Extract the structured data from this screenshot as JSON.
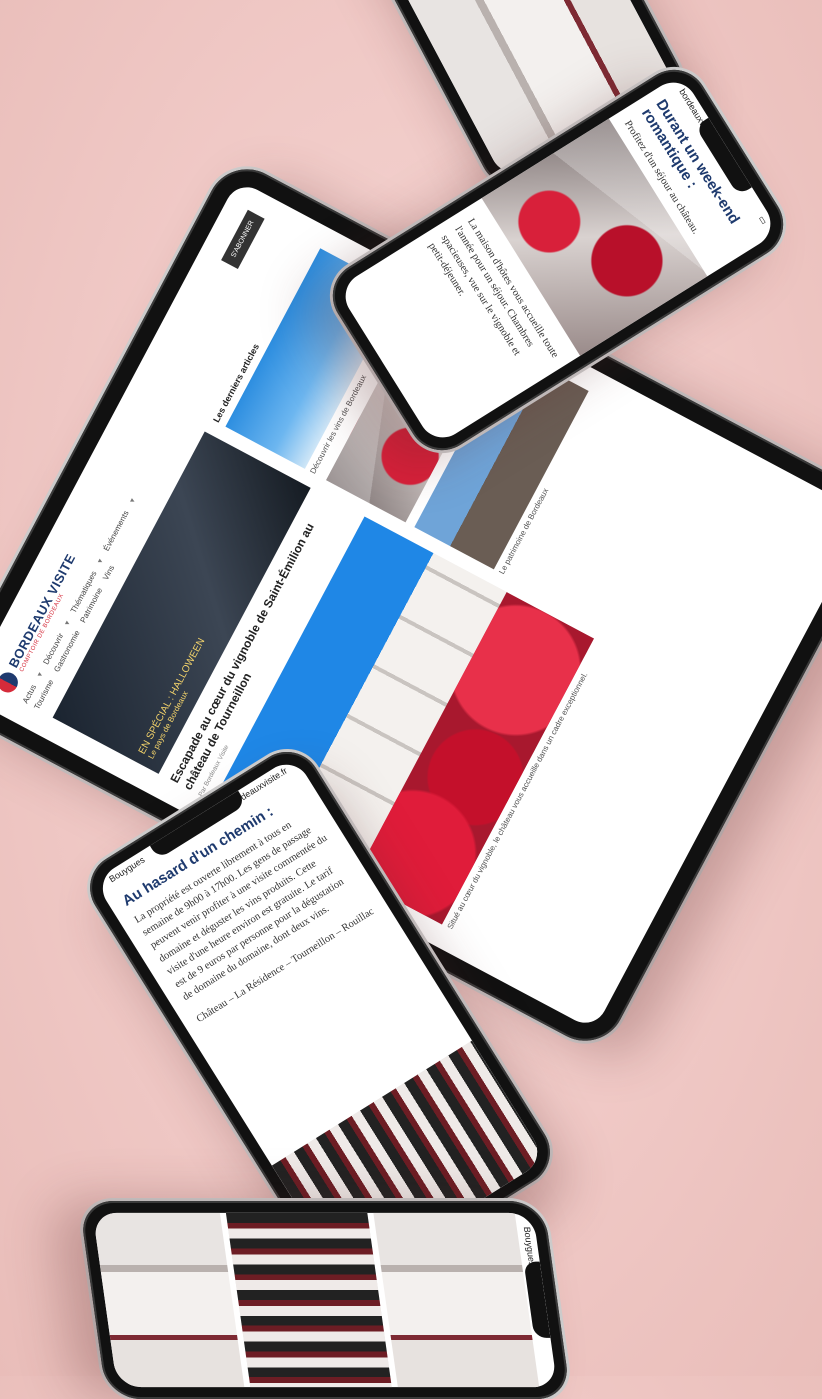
{
  "colors": {
    "background": "#f0c9c6",
    "accent_blue": "#1e3a6e",
    "accent_red": "#d52b3a"
  },
  "tablet": {
    "logo_title": "BORDEAUX VISITE",
    "logo_subtitle": "COMPTOIR DE BORDEAUX",
    "nav": [
      "Actus",
      "Découvrir",
      "Thématiques",
      "Événements"
    ],
    "nav_row2": [
      "Tourisme",
      "Gastronomie",
      "Patrimoine",
      "Vins"
    ],
    "button_label": "S'ABONNER",
    "featured_heading": "En spécial : halloween",
    "featured_caption": "Le pays de Bordeaux",
    "article_title": "Escapade au cœur du vignoble de Saint-Émilion au château de Tourneillon",
    "article_meta": "Par Bordeaux Visite",
    "sidebar_heading": "Les derniers articles",
    "sidebar_caption_1": "Découvrir les vins de Bordeaux",
    "sidebar_caption_2": "Le patrimoine de Bordeaux",
    "body_caption": "Situé au cœur du vignoble, le château vous accueille dans un cadre exceptionnel."
  },
  "phone_top": {
    "url": "bordeauxvisite.fr",
    "heading": "Durant un week-end romantique :",
    "intro": "Profitez d'un séjour au château.",
    "body": "La maison d'hôtes vous accueille toute l'année pour un séjour. Chambres spacieuses, vue sur le vignoble et petit-déjeuner."
  },
  "phone_middle": {
    "status": "Bouygues",
    "url": "bordeauxvisite.fr",
    "heading": "Au hasard d'un chemin :",
    "body": "La propriété est ouverte librement à tous en semaine de 9h00 à 17h00. Les gens de passage peuvent venir profiter à une visite commentée du domaine et déguster les vins produits. Cette visite d'une heure environ est gratuite. Le tarif est de 9 euros par personne pour la dégustation de domaine du domaine, dont deux vins.",
    "footer": "Château – La Résidence – Tourneillon – Rouillac"
  },
  "phone_bottom": {
    "status": "Bouygues"
  }
}
